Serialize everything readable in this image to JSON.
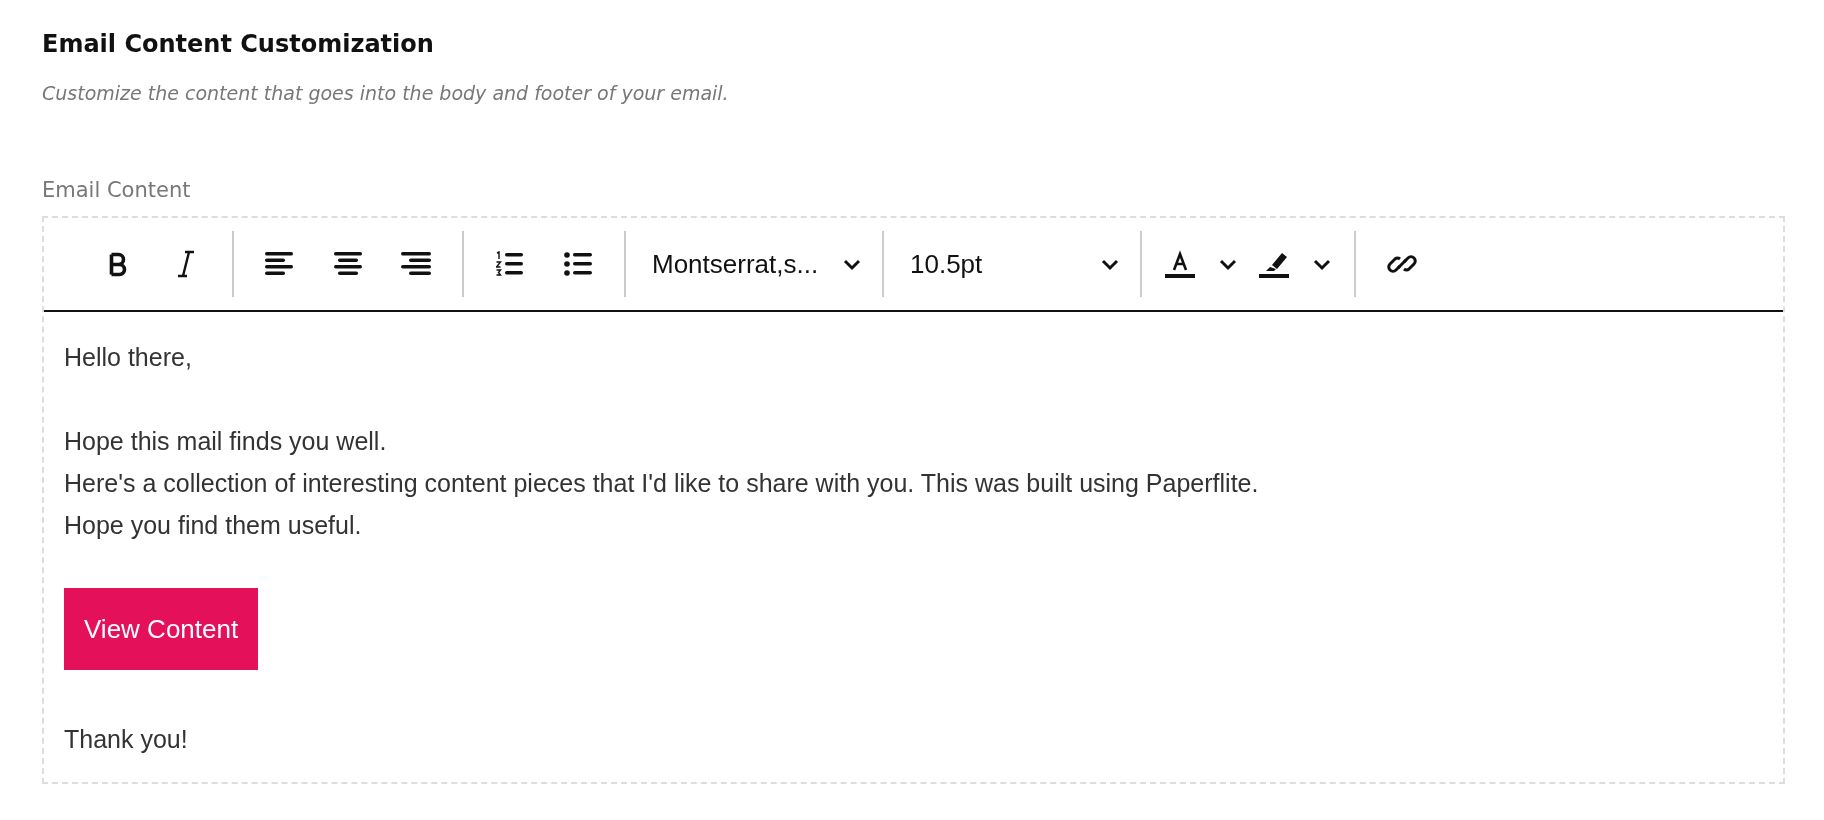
{
  "section": {
    "title": "Email Content Customization",
    "description": "Customize the content that goes into the body and footer of your email."
  },
  "editor": {
    "label": "Email Content",
    "toolbar": [
      {
        "items": [
          {
            "kind": "bold"
          },
          {
            "kind": "italic"
          }
        ]
      },
      {
        "items": [
          {
            "kind": "align-left"
          },
          {
            "kind": "align-center"
          },
          {
            "kind": "align-right"
          }
        ]
      },
      {
        "items": [
          {
            "kind": "numbered-list"
          },
          {
            "kind": "bulleted-list"
          }
        ]
      },
      {
        "items": [
          {
            "kind": "font-select",
            "value": "Montserrat,s..."
          }
        ]
      },
      {
        "items": [
          {
            "kind": "size-select",
            "value": "10.5pt"
          }
        ]
      },
      {
        "items": [
          {
            "kind": "text-color"
          },
          {
            "kind": "highlight"
          }
        ]
      },
      {
        "items": [
          {
            "kind": "link"
          }
        ]
      }
    ],
    "body": [
      {
        "kind": "paragraph",
        "lines": [
          "Hello there,"
        ]
      },
      {
        "kind": "paragraph",
        "lines": [
          "Hope this mail finds you well.",
          "Here's a collection of interesting content pieces that I'd like to share with you. This was built using Paperflite.",
          "Hope you find them useful."
        ]
      },
      {
        "kind": "button",
        "label": "View Content"
      },
      {
        "kind": "paragraph",
        "lines": [
          "Thank you!"
        ]
      }
    ]
  }
}
